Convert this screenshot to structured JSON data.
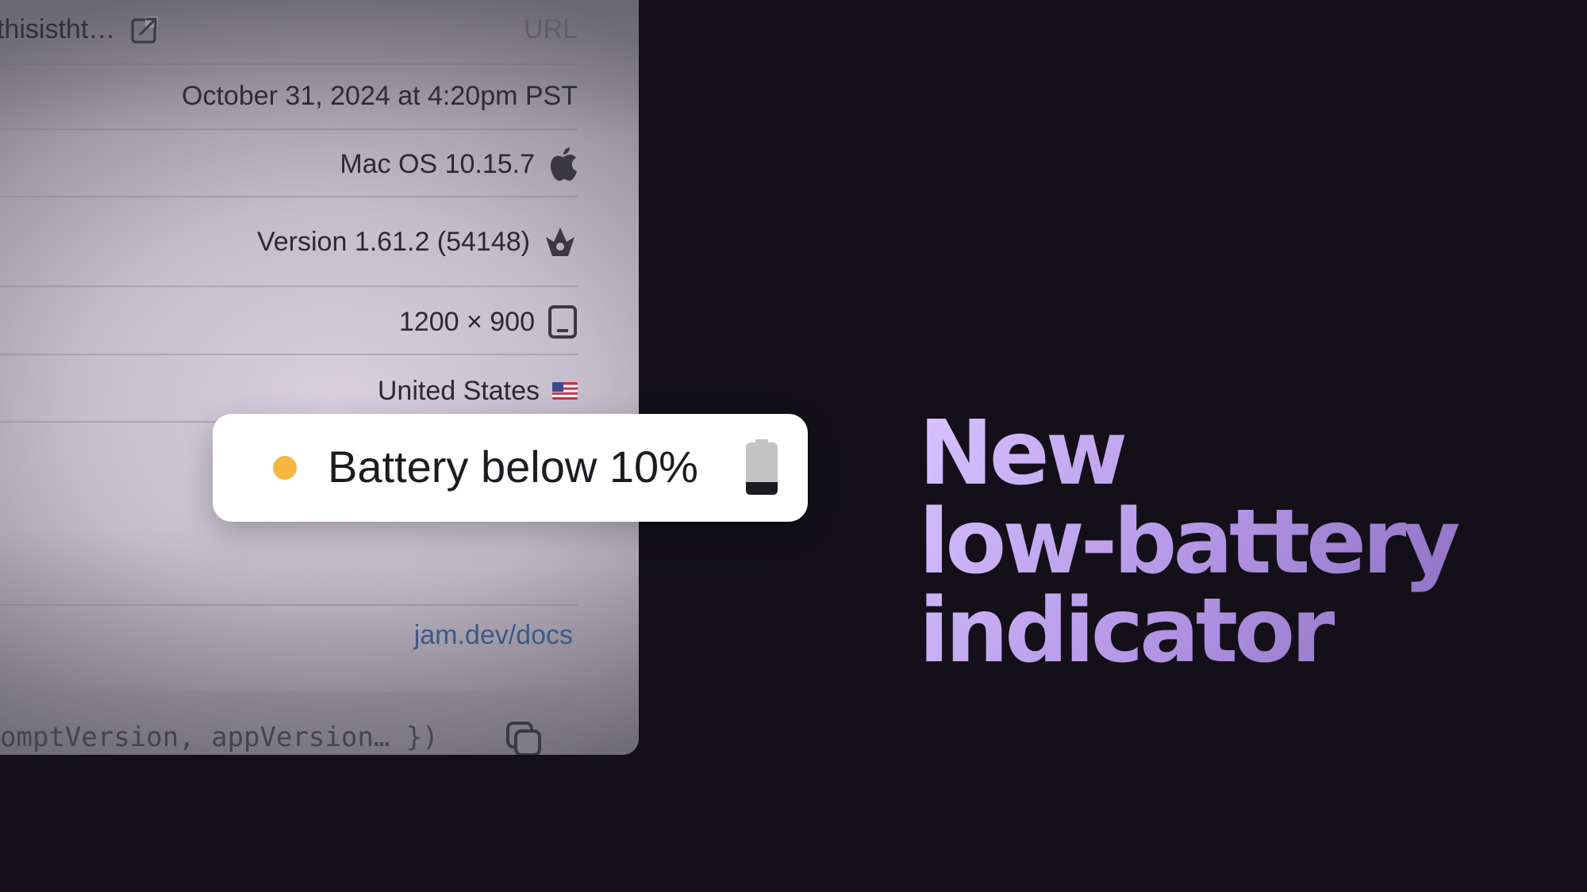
{
  "details": {
    "url_value": "thisistht…",
    "url_label": "URL",
    "timestamp": "October 31, 2024 at 4:20pm PST",
    "os": "Mac OS 10.15.7",
    "app_version": "Version 1.61.2 (54148)",
    "viewport": "1200 × 900",
    "country": "United States",
    "country_flag": "🇺🇸",
    "docs_link": "jam.dev/docs",
    "code_snippet": "omptVersion, appVersion… })"
  },
  "toast": {
    "message": "Battery below 10%",
    "status_color": "#f6b63f"
  },
  "headline": {
    "line1": "New",
    "line2": "low-battery",
    "line3": "indicator"
  },
  "icons": [
    "external-link-icon",
    "apple-icon",
    "app-icon",
    "device-icon",
    "copy-icon",
    "battery-icon"
  ],
  "colors": {
    "background": "#131019",
    "accent": "#b79ae8",
    "link": "#3f5f98"
  }
}
